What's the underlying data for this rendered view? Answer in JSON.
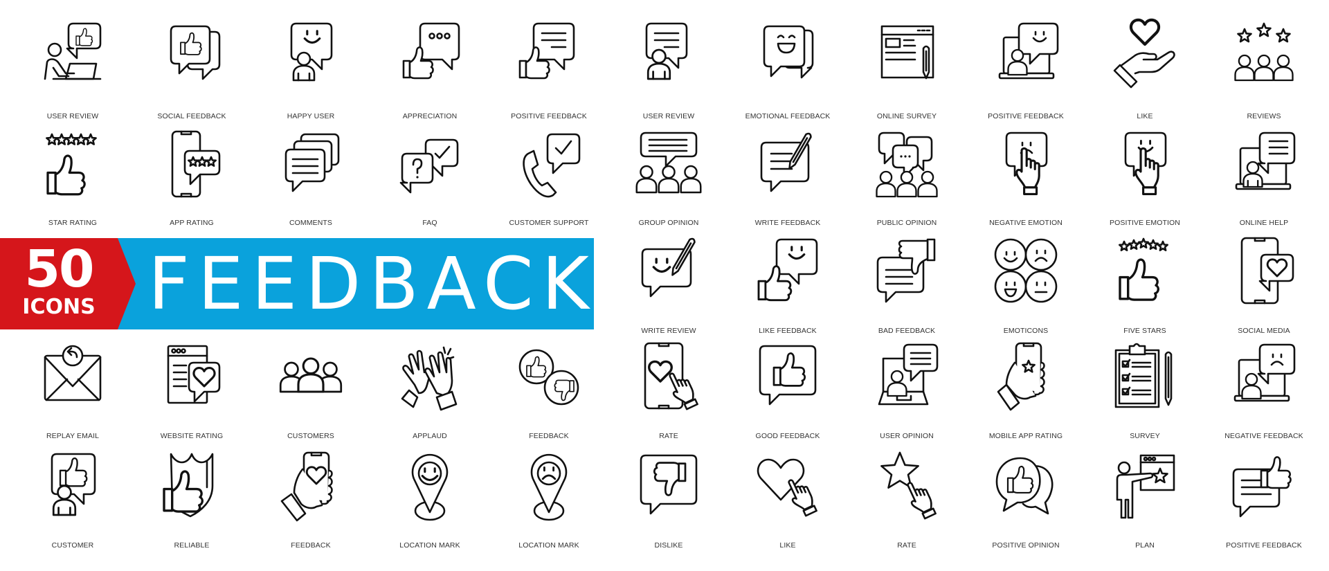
{
  "banner": {
    "count": "50",
    "count_label": "ICONS",
    "title": "FEEDBACK",
    "colors": {
      "red": "#d5161b",
      "blue": "#0aa2dc",
      "text": "#ffffff"
    }
  },
  "icons": [
    {
      "label": "USER REVIEW",
      "icon": "user-laptop-thumbs-up-icon"
    },
    {
      "label": "SOCIAL FEEDBACK",
      "icon": "speech-bubbles-thumbs-up-icon"
    },
    {
      "label": "HAPPY USER",
      "icon": "user-smile-bubble-icon"
    },
    {
      "label": "APPRECIATION",
      "icon": "thumbs-up-dots-bubble-icon"
    },
    {
      "label": "POSITIVE FEEDBACK",
      "icon": "thumbs-up-text-bubble-icon"
    },
    {
      "label": "USER REVIEW",
      "icon": "user-text-bubble-icon"
    },
    {
      "label": "EMOTIONAL FEEDBACK",
      "icon": "laughing-bubbles-icon"
    },
    {
      "label": "ONLINE SURVEY",
      "icon": "web-form-pencil-icon"
    },
    {
      "label": "POSITIVE FEEDBACK",
      "icon": "laptop-user-smile-icon"
    },
    {
      "label": "LIKE",
      "icon": "hand-heart-icon"
    },
    {
      "label": "REVIEWS",
      "icon": "stars-users-icon"
    },
    {
      "label": "STAR RATING",
      "icon": "stars-thumbs-up-icon"
    },
    {
      "label": "APP RATING",
      "icon": "phone-three-stars-icon"
    },
    {
      "label": "COMMENTS",
      "icon": "stacked-bubbles-icon"
    },
    {
      "label": "FAQ",
      "icon": "question-check-bubbles-icon"
    },
    {
      "label": "CUSTOMER SUPPORT",
      "icon": "phone-check-bubble-icon"
    },
    {
      "label": "GROUP OPINION",
      "icon": "group-text-bubble-icon"
    },
    {
      "label": "WRITE FEEDBACK",
      "icon": "bubble-pencil-icon"
    },
    {
      "label": "PUBLIC OPINION",
      "icon": "group-bubbles-icon"
    },
    {
      "label": "NEGATIVE EMOTION",
      "icon": "finger-sad-bubble-icon"
    },
    {
      "label": "POSITIVE EMOTION",
      "icon": "finger-smile-bubble-icon"
    },
    {
      "label": "ONLINE HELP",
      "icon": "laptop-user-text-icon"
    },
    {
      "label": "WRITE REVIEW",
      "icon": "smile-bubble-pencil-icon"
    },
    {
      "label": "LIKE FEEDBACK",
      "icon": "thumbs-up-smile-bubble-icon"
    },
    {
      "label": "BAD FEEDBACK",
      "icon": "thumbs-down-text-bubble-icon"
    },
    {
      "label": "EMOTICONS",
      "icon": "four-faces-icon"
    },
    {
      "label": "FIVE STARS",
      "icon": "five-stars-thumbs-up-icon"
    },
    {
      "label": "SOCIAL MEDIA",
      "icon": "phone-heart-bubble-icon"
    },
    {
      "label": "REPLAY EMAIL",
      "icon": "envelope-reply-icon"
    },
    {
      "label": "WEBSITE RATING",
      "icon": "browser-heart-bubble-icon"
    },
    {
      "label": "CUSTOMERS",
      "icon": "three-users-icon"
    },
    {
      "label": "APPLAUD",
      "icon": "clapping-hands-icon"
    },
    {
      "label": "FEEDBACK",
      "icon": "thumbs-up-down-circles-icon"
    },
    {
      "label": "RATE",
      "icon": "phone-heart-finger-icon"
    },
    {
      "label": "GOOD FEEDBACK",
      "icon": "thumbs-up-bubble-icon"
    },
    {
      "label": "USER OPINION",
      "icon": "laptop-user-bubble-icon"
    },
    {
      "label": "MOBILE APP RATING",
      "icon": "hand-phone-star-icon"
    },
    {
      "label": "SURVEY",
      "icon": "clipboard-checklist-pencil-icon"
    },
    {
      "label": "NEGATIVE FEEDBACK",
      "icon": "laptop-user-sad-icon"
    },
    {
      "label": "CUSTOMER",
      "icon": "user-thumbs-up-bubble-icon"
    },
    {
      "label": "RELIABLE",
      "icon": "shield-thumbs-up-icon"
    },
    {
      "label": "FEEDBACK",
      "icon": "hand-phone-heart-icon"
    },
    {
      "label": "LOCATION MARK",
      "icon": "pin-smile-icon"
    },
    {
      "label": "LOCATION MARK",
      "icon": "pin-sad-icon"
    },
    {
      "label": "DISLIKE",
      "icon": "thumbs-down-bubble-icon"
    },
    {
      "label": "LIKE",
      "icon": "heart-finger-icon"
    },
    {
      "label": "RATE",
      "icon": "star-finger-icon"
    },
    {
      "label": "POSITIVE OPINION",
      "icon": "round-bubbles-thumbs-up-icon"
    },
    {
      "label": "PLAN",
      "icon": "presenter-star-board-icon"
    },
    {
      "label": "POSITIVE FEEDBACK",
      "icon": "text-bubble-thumbs-up-icon"
    }
  ]
}
